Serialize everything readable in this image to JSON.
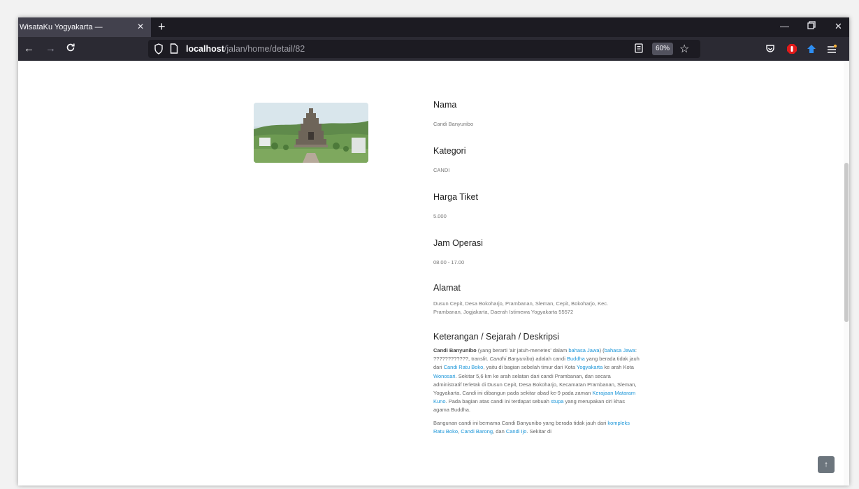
{
  "browser": {
    "tab": {
      "title": "WisataKu Yogyakarta —",
      "close_icon": "close-icon"
    },
    "new_tab_icon": "plus-icon",
    "window_controls": [
      "minimize-icon",
      "restore-icon",
      "close-icon"
    ],
    "nav": {
      "back_icon": "arrow-left-icon",
      "forward_icon": "arrow-right-icon",
      "reload_icon": "reload-icon"
    },
    "url": {
      "host": "localhost",
      "path": "/jalan/home/detail/82"
    },
    "zoom": "60%",
    "extensions": [
      "pocket-icon",
      "adblock-icon",
      "shield-extension-icon",
      "menu-icon"
    ]
  },
  "detail": {
    "image_alt": "Candi Banyunibo",
    "fields": [
      {
        "label": "Nama",
        "value": "Candi Banyunibo"
      },
      {
        "label": "Kategori",
        "value": "CANDI"
      },
      {
        "label": "Harga Tiket",
        "value": "5.000"
      },
      {
        "label": "Jam Operasi",
        "value": "08.00 - 17.00"
      },
      {
        "label": "Alamat",
        "value": "Dusun Cepit, Desa Bokoharjo, Prambanan, Sleman, Cepit, Bokoharjo, Kec. Prambanan, Jogjakarta, Daerah Istimewa Yogyakarta 55572"
      }
    ],
    "description": {
      "title": "Keterangan / Sejarah / Deskripsi",
      "bold_name": "Candi Banyunibo",
      "t1": " (yang berarti 'air jatuh-menetes' dalam ",
      "link_bahasa_jawa": "bahasa Jawa",
      "t2": ") (",
      "t3": ": ????????????, translit. ",
      "italic_name": "Candhi Banyuniba",
      "t4": ") adalah candi ",
      "link_buddha": "Buddha",
      "t5": " yang berada tidak jauh dari ",
      "link_ratu_boko": "Candi Ratu Boko",
      "t6": ", yaitu di bagian sebelah timur dari Kota ",
      "link_yogyakarta": "Yogyakarta",
      "t7": " ke arah Kota ",
      "link_wonosari": "Wonosari",
      "t8": ". Sekitar 5,6 km ke arah selatan dari candi Prambanan, dan secara administratif terletak di Dusun Cepit, Desa Bokoharjo, Kecamatan Prambanan, Sleman, Yogyakarta. Candi ini dibangun pada sekitar abad ke-9 pada zaman ",
      "link_mataram": "Kerajaan Mataram Kuno",
      "t9": ". Pada bagian atas candi ini terdapat sebuah ",
      "link_stupa": "stupa",
      "t10": " yang merupakan ciri khas agama Buddha.",
      "p2a": "Bangunan candi ini bernama Candi Banyunibo yang berada tidak jauh dari ",
      "p2_link1": "kompleks Ratu Boko",
      "p2b": ", ",
      "p2_link2": "Candi Barong",
      "p2c": ", dan ",
      "p2_link3": "Candi Ijo",
      "p2d": ". Sekitar di"
    }
  },
  "back_to_top_icon": "arrow-up-icon"
}
